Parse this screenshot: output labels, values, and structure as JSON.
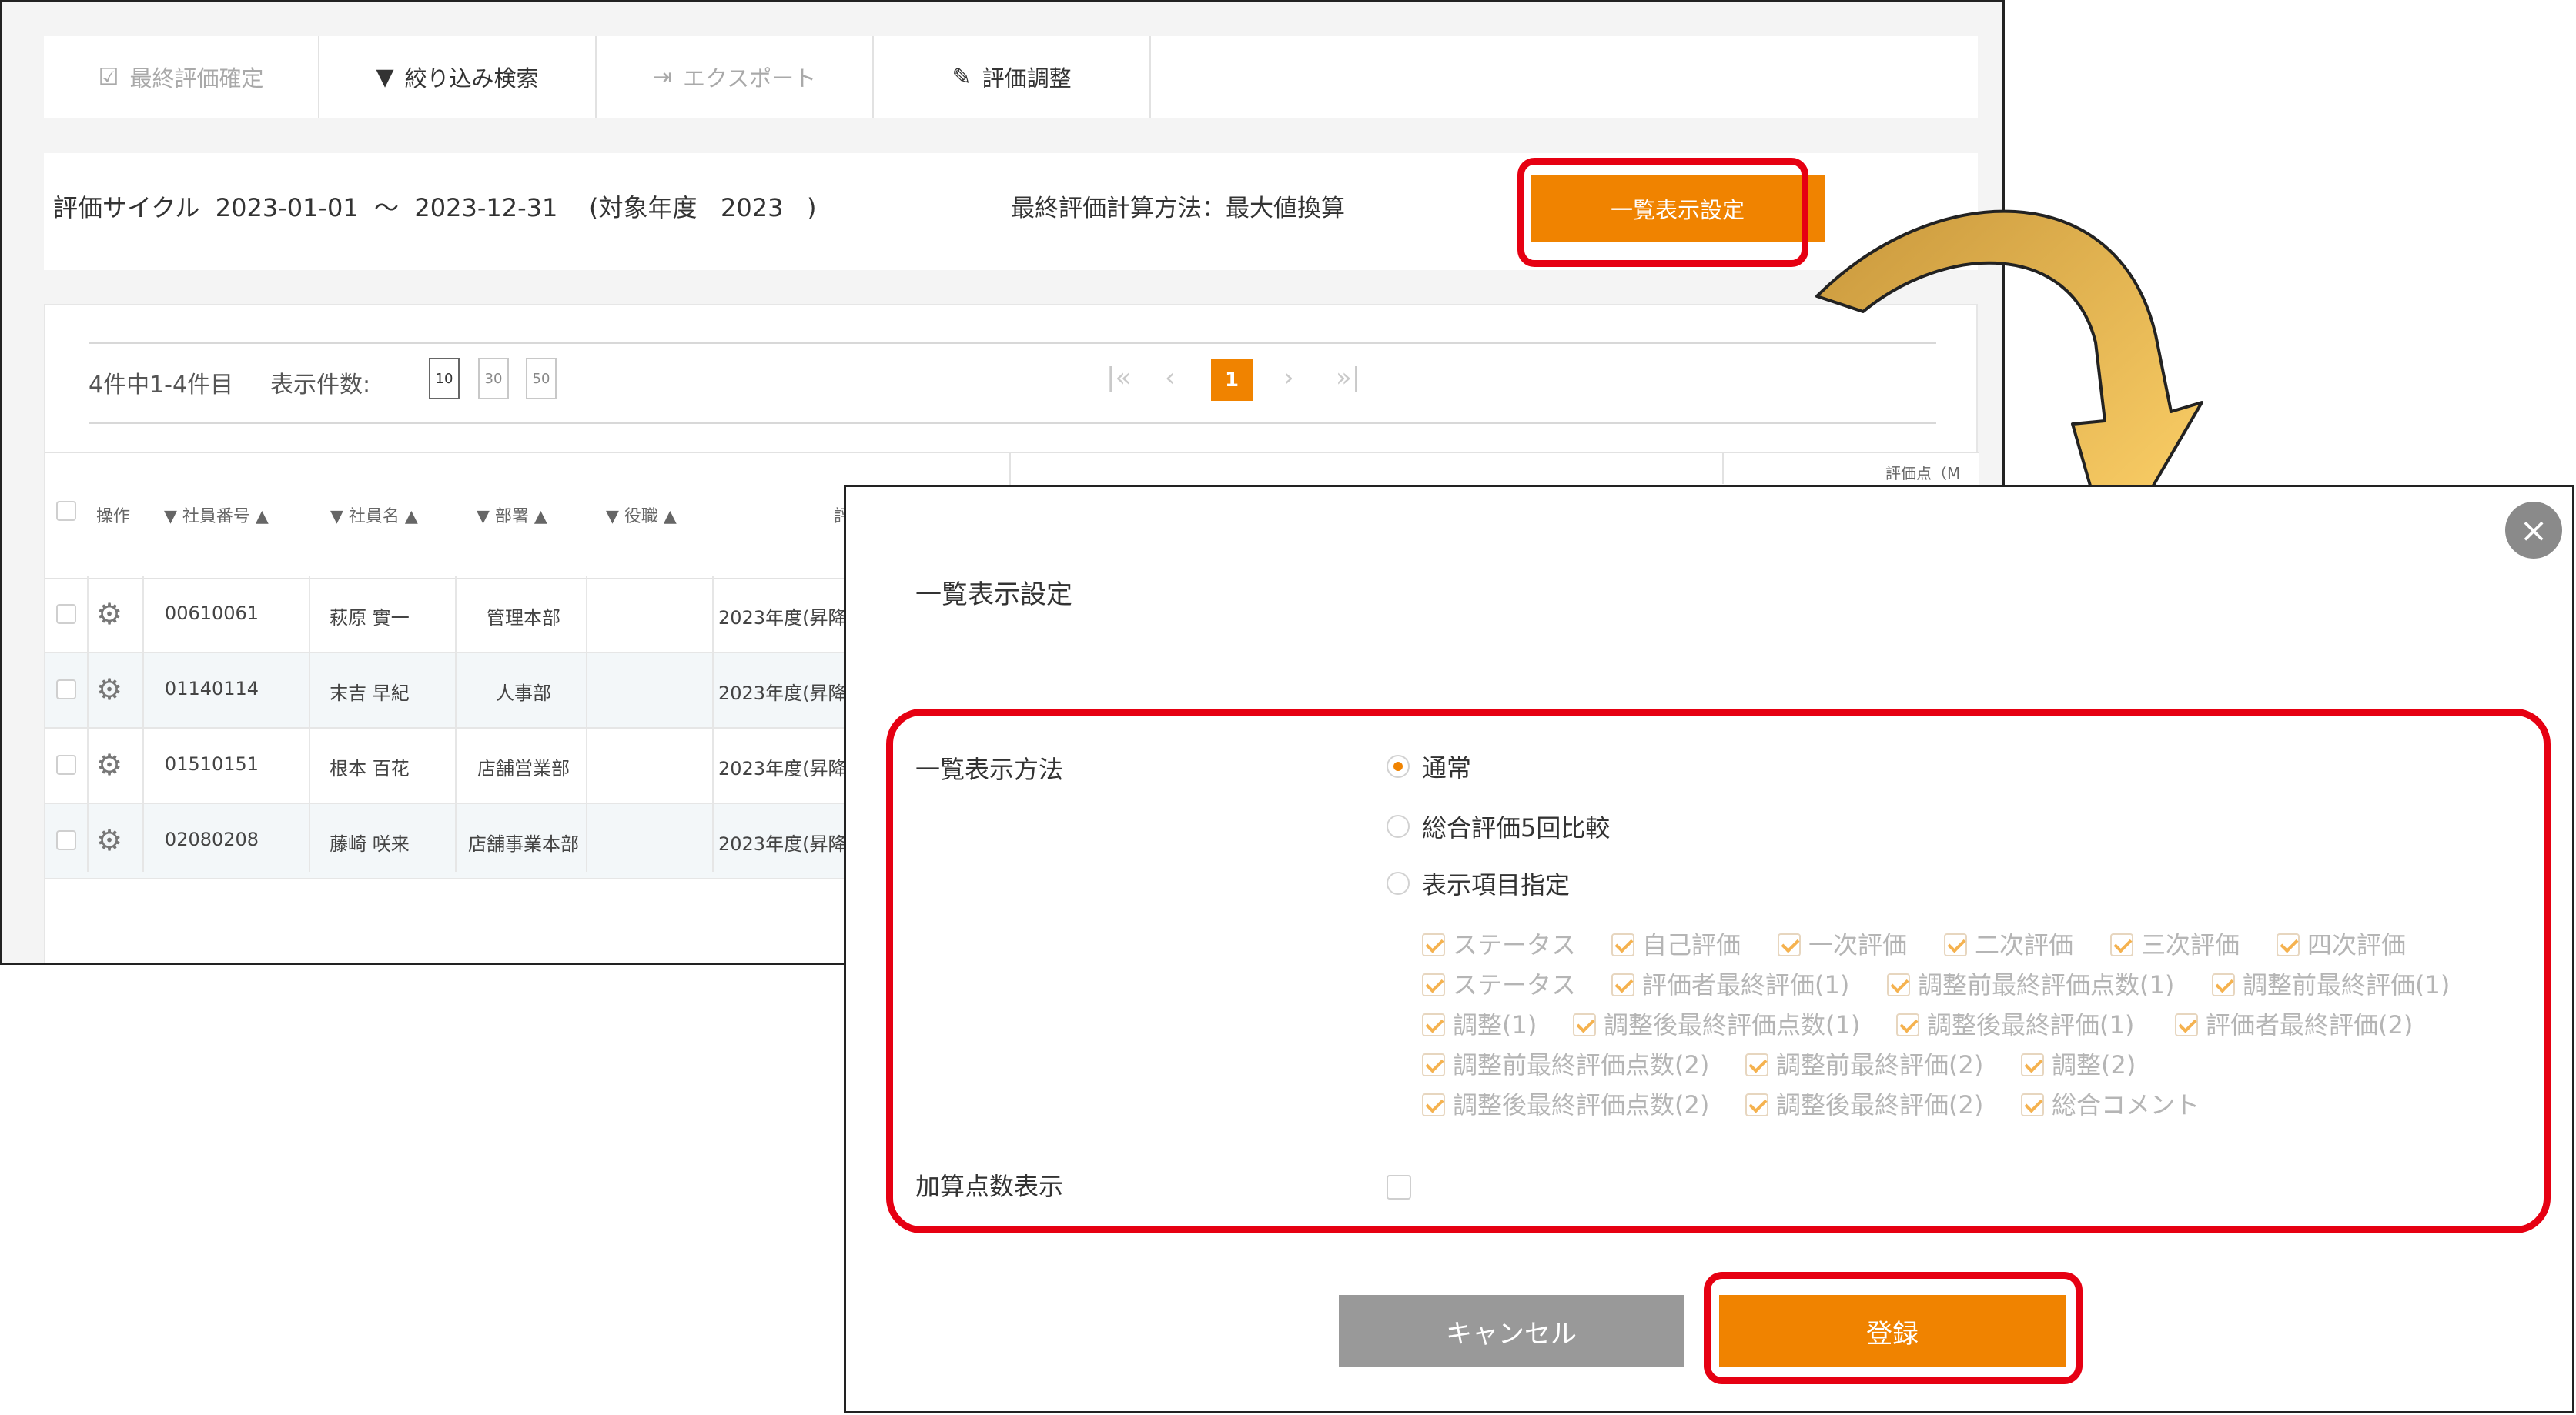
{
  "toolbar": {
    "items": [
      {
        "label": "最終評価確定",
        "icon": "checkbox-edit-icon",
        "enabled": false
      },
      {
        "label": "絞り込み検索",
        "icon": "filter-icon",
        "enabled": true
      },
      {
        "label": "エクスポート",
        "icon": "export-icon",
        "enabled": false
      },
      {
        "label": "評価調整",
        "icon": "pencil-icon",
        "enabled": true
      }
    ]
  },
  "info": {
    "cycle": "評価サイクル  2023-01-01  ～  2023-12-31    (対象年度   2023   )",
    "calc_method": "最終評価計算方法：最大値換算",
    "list_settings_button": "一覧表示設定"
  },
  "pager": {
    "count": "4件中1-4件目",
    "per_page_label": "表示件数:",
    "per_page_options": [
      "10",
      "30",
      "50"
    ],
    "current_page": "1"
  },
  "table": {
    "headers": {
      "ops": "操作",
      "emp_no": "▼ 社員番号 ▲",
      "emp_name": "▼ 社員名 ▲",
      "dept": "▼ 部署 ▲",
      "position": "▼ 役職 ▲",
      "eval_partial": "評",
      "score_partial": "評価点（M"
    },
    "rows": [
      {
        "emp_no": "00610061",
        "name": "萩原 實一",
        "dept": "管理本部",
        "position": "",
        "cycle": "2023年度(昇降"
      },
      {
        "emp_no": "01140114",
        "name": "末吉 早紀",
        "dept": "人事部",
        "position": "",
        "cycle": "2023年度(昇降"
      },
      {
        "emp_no": "01510151",
        "name": "根本 百花",
        "dept": "店舗営業部",
        "position": "",
        "cycle": "2023年度(昇降"
      },
      {
        "emp_no": "02080208",
        "name": "藤崎 咲来",
        "dept": "店舗事業本部",
        "position": "",
        "cycle": "2023年度(昇降"
      }
    ]
  },
  "modal": {
    "title": "一覧表示設定",
    "display_method_label": "一覧表示方法",
    "radios": [
      {
        "label": "通常",
        "selected": true
      },
      {
        "label": "総合評価5回比較",
        "selected": false
      },
      {
        "label": "表示項目指定",
        "selected": false
      }
    ],
    "checkbox_rows": [
      [
        "ステータス",
        "自己評価",
        "一次評価",
        "二次評価",
        "三次評価",
        "四次評価"
      ],
      [
        "ステータス",
        "評価者最終評価(1)",
        "調整前最終評価点数(1)",
        "調整前最終評価(1)"
      ],
      [
        "調整(1)",
        "調整後最終評価点数(1)",
        "調整後最終評価(1)",
        "評価者最終評価(2)"
      ],
      [
        "調整前最終評価点数(2)",
        "調整前最終評価(2)",
        "調整(2)"
      ],
      [
        "調整後最終評価点数(2)",
        "調整後最終評価(2)",
        "総合コメント"
      ]
    ],
    "addition_label": "加算点数表示",
    "cancel": "キャンセル",
    "submit": "登録",
    "close_glyph": "×"
  },
  "colors": {
    "accent": "#f08300",
    "highlight": "#e60012",
    "arrow_fill": "#d4a84e"
  }
}
